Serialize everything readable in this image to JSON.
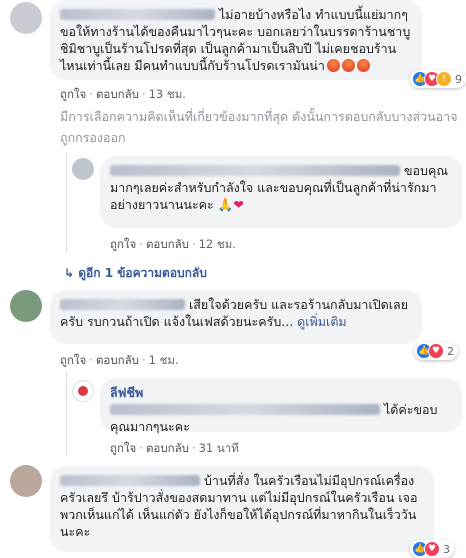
{
  "comments": [
    {
      "text": "ไม่อายบ้างหรือไง ทำแบบนี้แย่มากๆ ขอให้ทางร้านได้ของคืนมาไวๆนะคะ บอกเลยว่าในบรรดาร้านชาบูชิมิชาบูเป็นร้านโปรดที่สุด เป็นลูกค้ามาเป็นสิบปี ไม่เคยชอบร้านไหนเท่านี้เลย มีคนทำแบบนี้กับร้านโปรดเรามันน่า",
      "like": "ถูกใจ",
      "reply": "ตอบกลับ",
      "time": "13 ชม.",
      "reaction_count": "9"
    },
    {
      "text": "เสียใจด้วยครับ และรอร้านกลับมาเปิดเลยครับ รบกวนถ้าเปิด แจ้งในเฟสด้วยนะครับ...",
      "see_more": "ดูเพิ่มเติม",
      "like": "ถูกใจ",
      "reply": "ตอบกลับ",
      "time": "1 ชม.",
      "reaction_count": "2"
    },
    {
      "text": "บ้านที่สั่ง ในครัวเรือนไม่มีอุปกรณ์เครื่องครัวเลยรึ บ้าร้ปาวสั่งของสดมาทาน แต่ไม่มีอุปกรณ์ในครัวเรือน เจอพวกเห็นแก่ได้ เห็นแก่ตัว ยังไงก็ขอให้ได้อุปกรณ์ที่มาหากินในเร็ววันนะคะ",
      "reaction_count": "3"
    }
  ],
  "notice": "มีการเลือกความคิดเห็นที่เกี่ยวข้องมากที่สุด ดังนั้นการตอบกลับบางส่วนอาจถูกกรองออก",
  "replies": [
    {
      "text": "ขอบคุณมากๆเลยค่ะสำหรับกำลังใจ และขอบคุณที่เป็นลูกค้าที่น่ารักมาอย่างยาวนานนะคะ",
      "like": "ถูกใจ",
      "reply": "ตอบกลับ",
      "time": "12 ชม."
    },
    {
      "author": "ลีฟชีพ",
      "text": "ได้ค่ะขอบคุณมากๆนะคะ",
      "like": "ถูกใจ",
      "reply": "ตอบกลับ",
      "time": "31 นาที"
    }
  ],
  "view_replies": "ดูอีก 1 ข้อความตอบกลับ",
  "colors": {
    "like": "#2078f4",
    "love": "#f33e58",
    "wow": "#f7b125",
    "link": "#385898"
  }
}
